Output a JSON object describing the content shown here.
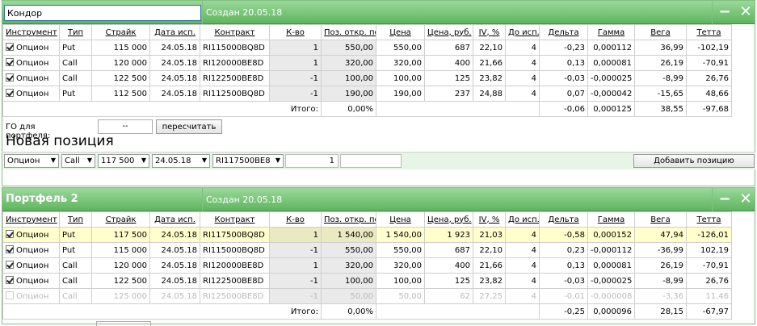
{
  "columns": [
    "Инструмент",
    "Тип",
    "Страйк",
    "Дата исп.",
    "Контракт",
    "К-во",
    "Поз. откр. по",
    "Цена",
    "Цена, руб.",
    "IV, %",
    "До исп.",
    "Дельта",
    "Гамма",
    "Вега",
    "Тетта"
  ],
  "total_label": "Итого:",
  "portfolio1": {
    "name_value": "Кондор",
    "created": "Создан 20.05.18",
    "rows": [
      {
        "checked": true,
        "cells": [
          "Опцион",
          "Put",
          "115 000",
          "24.05.18",
          "RI115000BQ8D",
          "1",
          "550,00",
          "550,00",
          "687",
          "22,10",
          "4",
          "-0,23",
          "0,000112",
          "36,99",
          "-102,19"
        ]
      },
      {
        "checked": true,
        "cells": [
          "Опцион",
          "Call",
          "120 000",
          "24.05.18",
          "RI120000BE8D",
          "1",
          "320,00",
          "320,00",
          "400",
          "21,66",
          "4",
          "0,13",
          "0,000081",
          "26,19",
          "-70,91"
        ]
      },
      {
        "checked": true,
        "cells": [
          "Опцион",
          "Call",
          "122 500",
          "24.05.18",
          "RI122500BE8D",
          "-1",
          "100,00",
          "100,00",
          "125",
          "23,82",
          "4",
          "-0,03",
          "-0,000025",
          "-8,99",
          "26,76"
        ]
      },
      {
        "checked": true,
        "cells": [
          "Опцион",
          "Put",
          "112 500",
          "24.05.18",
          "RI112500BQ8D",
          "-1",
          "190,00",
          "190,00",
          "237",
          "24,88",
          "4",
          "0,07",
          "-0,000042",
          "-15,65",
          "48,66"
        ]
      }
    ],
    "totals": {
      "pct": "0,00%",
      "delta": "-0,06",
      "gamma": "0,000125",
      "vega": "38,55",
      "theta": "-97,68"
    },
    "go_label": "ГО для портфеля:",
    "go_value": "--",
    "recalc_label": "пересчитать",
    "new_position_title": "Новая позиция",
    "new_position": {
      "instrument": "Опцион",
      "type": "Call",
      "strike": "117 500",
      "date": "24.05.18",
      "contract": "RI117500BE8",
      "qty": "1",
      "add_label": "Добавить позицию"
    }
  },
  "portfolio2": {
    "name": "Портфель 2",
    "created": "Создан 20.05.18",
    "rows": [
      {
        "checked": true,
        "highlight": true,
        "cells": [
          "Опцион",
          "Put",
          "117 500",
          "24.05.18",
          "RI117500BQ8D",
          "1",
          "1 540,00",
          "1 540,00",
          "1 923",
          "21,03",
          "4",
          "-0,58",
          "0,000152",
          "47,94",
          "-126,01"
        ]
      },
      {
        "checked": true,
        "cells": [
          "Опцион",
          "Put",
          "115 000",
          "24.05.18",
          "RI115000BQ8D",
          "-1",
          "550,00",
          "550,00",
          "687",
          "22,10",
          "4",
          "0,23",
          "-0,000112",
          "-36,99",
          "102,19"
        ]
      },
      {
        "checked": true,
        "cells": [
          "Опцион",
          "Call",
          "120 000",
          "24.05.18",
          "RI120000BE8D",
          "1",
          "320,00",
          "320,00",
          "400",
          "21,66",
          "4",
          "0,13",
          "0,000081",
          "26,19",
          "-70,91"
        ]
      },
      {
        "checked": true,
        "cells": [
          "Опцион",
          "Call",
          "122 500",
          "24.05.18",
          "RI122500BE8D",
          "-1",
          "100,00",
          "100,00",
          "125",
          "23,82",
          "4",
          "-0,03",
          "-0,000025",
          "-8,99",
          "26,76"
        ]
      },
      {
        "checked": false,
        "dim": true,
        "cells": [
          "Опцион",
          "Call",
          "125 000",
          "24.05.18",
          "RI125000BE8D",
          "-1",
          "50,00",
          "50,00",
          "62",
          "27,25",
          "4",
          "-0,01",
          "-0,000008",
          "-3,36",
          "11,46"
        ]
      }
    ],
    "totals": {
      "pct": "0,00%",
      "delta": "-0,25",
      "gamma": "0,000096",
      "vega": "28,15",
      "theta": "-67,97"
    }
  },
  "icons": {
    "minimize": "minimize-icon",
    "close": "close-icon",
    "checkbox": "checkbox-icon",
    "dropdown": "dropdown-arrow-icon"
  },
  "colors": {
    "header_green": "#5fb55f",
    "highlight_row": "#ffffcc",
    "qty_gray": "#eaeaea"
  }
}
